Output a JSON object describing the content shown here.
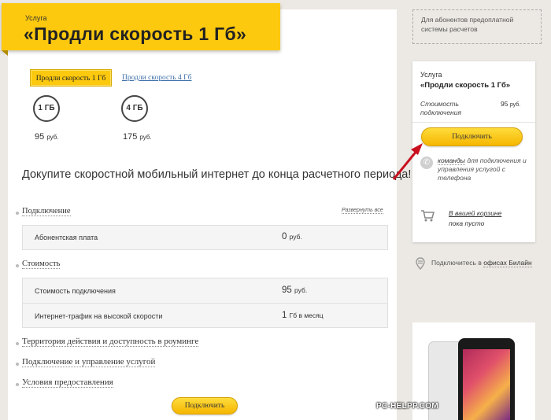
{
  "banner": {
    "small": "Услуга",
    "title": "«Продли скорость 1 Гб»"
  },
  "tabs": [
    {
      "label": "Продли скорость 1 Гб",
      "active": true
    },
    {
      "label": "Продли скорость 4 Гб",
      "active": false
    }
  ],
  "options": [
    {
      "circle": "1 ГБ",
      "price": "95",
      "unit": "руб."
    },
    {
      "circle": "4 ГБ",
      "price": "175",
      "unit": "руб."
    }
  ],
  "tagline": "Докупите скоростной мобильный интернет до конца расчетного периода!",
  "expand_all": "Развернуть все",
  "sections": {
    "connection": {
      "title": "Подключение",
      "rows": [
        {
          "label": "Абонентская плата",
          "value": "0",
          "unit": "руб."
        }
      ]
    },
    "cost": {
      "title": "Стоимость",
      "rows": [
        {
          "label": "Стоимость подключения",
          "value": "95",
          "unit": "руб."
        },
        {
          "label": "Интернет-трафик на высокой скорости",
          "value": "1",
          "unit": "Гб в месяц"
        }
      ]
    }
  },
  "links": {
    "roaming": "Территория действия и доступность в роуминге",
    "manage": "Подключение и управление услугой",
    "terms": "Условия предоставления"
  },
  "connect_label": "Подключить",
  "sidebar": {
    "notice": "Для абонентов предоплатной системы расчетов",
    "small": "Услуга",
    "title": "«Продли скорость 1 Гб»",
    "cost_label_1": "Стоимость",
    "cost_label_2": "подключения",
    "cost_value": "95",
    "cost_unit": "руб.",
    "connect_label": "Подключить",
    "commands_link": "команды",
    "commands_rest": "для подключения и управления услугой с телефона",
    "cart_link": "В вашей корзине",
    "cart_status": "пока пусто",
    "offices_prefix": "Подключитесь в",
    "offices_link": "офисах Билайн"
  },
  "watermark": "PC-HELPP.COM",
  "colors": {
    "brand_yellow": "#fdc90e",
    "arrow_red": "#c8101e",
    "link_blue": "#3b6ea8",
    "background": "#ece9e4"
  },
  "icons": [
    "phone-icon",
    "cart-icon",
    "map-pin-icon"
  ]
}
